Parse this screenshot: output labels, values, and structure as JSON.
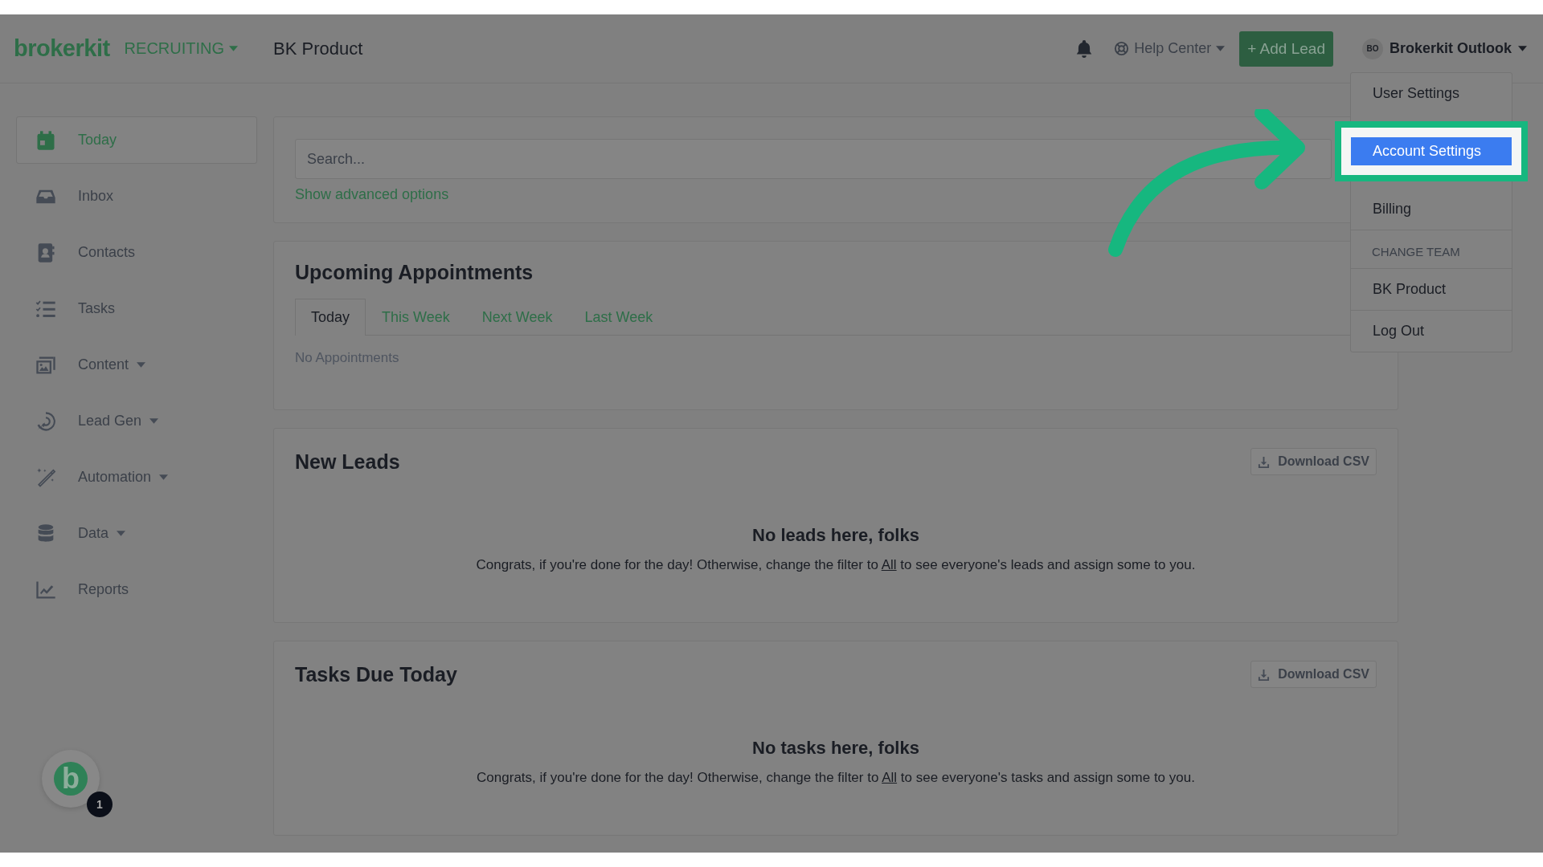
{
  "header": {
    "logo": "brokerkit",
    "team_menu": "RECRUITING",
    "team_name": "BK Product",
    "help": "Help Center",
    "add_lead": "+ Add Lead",
    "user_initials": "BO",
    "user_name": "Brokerkit Outlook"
  },
  "user_menu": {
    "items": [
      {
        "kind": "item",
        "label": "User Settings",
        "selected": false
      },
      {
        "kind": "item",
        "label": "Account Settings",
        "selected": true
      },
      {
        "kind": "item",
        "label": "Billing",
        "selected": false
      },
      {
        "kind": "header",
        "label": "CHANGE TEAM"
      },
      {
        "kind": "item",
        "label": "BK Product",
        "selected": false
      },
      {
        "kind": "item",
        "label": "Log Out",
        "selected": false
      }
    ]
  },
  "sidebar": {
    "items": [
      {
        "label": "Today",
        "selected": true,
        "expandable": false
      },
      {
        "label": "Inbox",
        "selected": false,
        "expandable": false
      },
      {
        "label": "Contacts",
        "selected": false,
        "expandable": false
      },
      {
        "label": "Tasks",
        "selected": false,
        "expandable": false
      },
      {
        "label": "Content",
        "selected": false,
        "expandable": true
      },
      {
        "label": "Lead Gen",
        "selected": false,
        "expandable": true
      },
      {
        "label": "Automation",
        "selected": false,
        "expandable": true
      },
      {
        "label": "Data",
        "selected": false,
        "expandable": true
      },
      {
        "label": "Reports",
        "selected": false,
        "expandable": false
      }
    ]
  },
  "search": {
    "placeholder": "Search...",
    "advanced_link": "Show advanced options"
  },
  "appointments": {
    "title": "Upcoming Appointments",
    "tabs": [
      {
        "label": "Today",
        "selected": true
      },
      {
        "label": "This Week",
        "selected": false
      },
      {
        "label": "Next Week",
        "selected": false
      },
      {
        "label": "Last Week",
        "selected": false
      }
    ],
    "empty": "No Appointments"
  },
  "sections": [
    {
      "title": "New Leads",
      "button": "Download CSV",
      "empty_title": "No leads here, folks",
      "empty_before": "Congrats, if you're done for the day! Otherwise, change the filter to ",
      "empty_link": "All",
      "empty_after": " to see everyone's leads and assign some to you."
    },
    {
      "title": "Tasks Due Today",
      "button": "Download CSV",
      "empty_title": "No tasks here, folks",
      "empty_before": "Congrats, if you're done for the day! Otherwise, change the filter to ",
      "empty_link": "All",
      "empty_after": " to see everyone's tasks and assign some to you."
    }
  ],
  "chat_widget": {
    "logo": "b",
    "badge": "1"
  }
}
